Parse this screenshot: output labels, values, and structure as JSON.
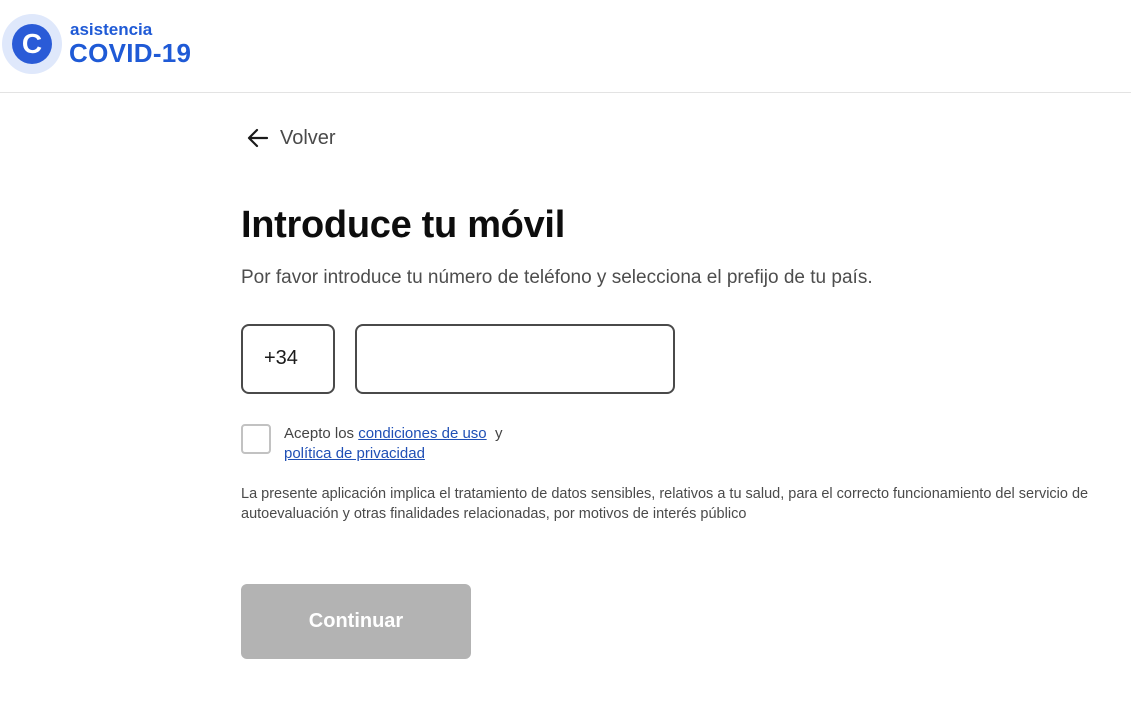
{
  "brand": {
    "logo_letter": "C",
    "name_top": "asistencia",
    "name_bottom": "COVID-19",
    "color": "#1f5ad6"
  },
  "nav": {
    "back_icon": "arrow-left-icon",
    "back_label": "Volver"
  },
  "form": {
    "title": "Introduce tu móvil",
    "subtitle": "Por favor introduce tu número de teléfono y selecciona el prefijo de tu país.",
    "prefix_value": "+34",
    "phone_value": "",
    "phone_placeholder": "",
    "consent": {
      "checked": false,
      "prefix": "Acepto los",
      "terms_link": "condiciones de uso",
      "conjunction": "y",
      "privacy_link": "política de privacidad"
    },
    "legal_text": "La presente aplicación implica el tratamiento de datos sensibles, relativos a tu salud, para el correcto funcionamiento del servicio de autoevaluación y otras finalidades relacionadas, por motivos de interés público",
    "continue_label": "Continuar",
    "continue_disabled": true
  },
  "colors": {
    "link": "#1f4fb5",
    "button_disabled": "#b3b3b3",
    "border": "#4a4a4a"
  }
}
